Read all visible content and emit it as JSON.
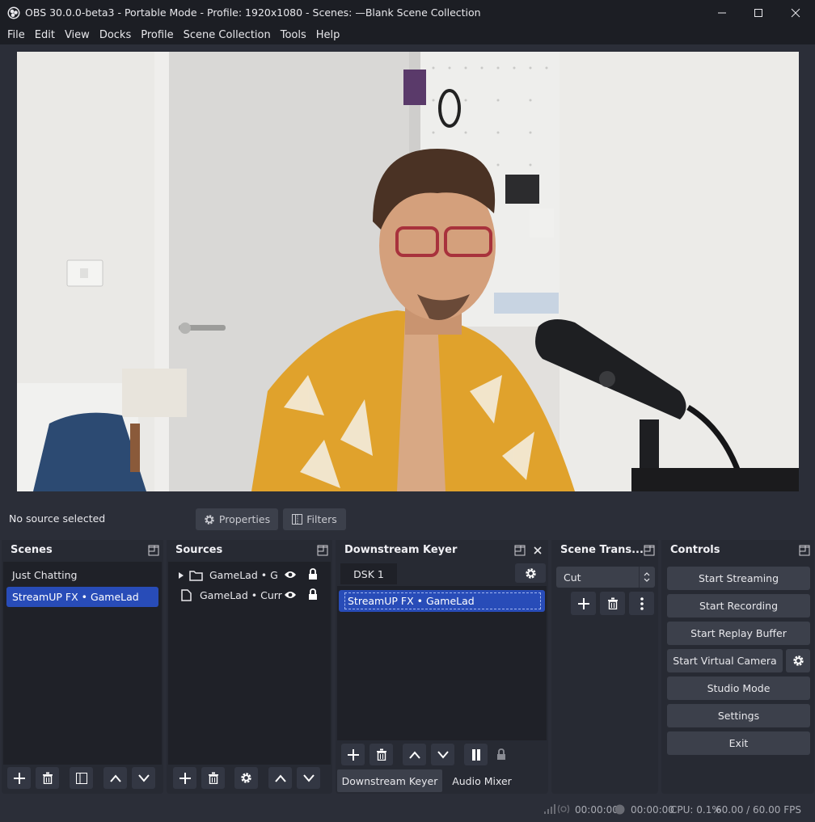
{
  "window": {
    "title": "OBS 30.0.0-beta3 - Portable Mode - Profile: 1920x1080 - Scenes: —Blank Scene Collection",
    "controls": [
      "minimize-icon",
      "maximize-icon",
      "close-icon"
    ]
  },
  "menu": [
    "File",
    "Edit",
    "View",
    "Docks",
    "Profile",
    "Scene Collection",
    "Tools",
    "Help"
  ],
  "context": {
    "label": "No source selected",
    "properties": "Properties",
    "filters": "Filters"
  },
  "scenes": {
    "title": "Scenes",
    "items": [
      "Just Chatting",
      "StreamUP FX • GameLad"
    ],
    "selected_index": 1
  },
  "sources": {
    "title": "Sources",
    "items": [
      {
        "label": "GameLad • Grou",
        "icon": "folder-icon"
      },
      {
        "label": "GameLad • Curren",
        "icon": "file-icon"
      }
    ]
  },
  "dsk": {
    "title": "Downstream Keyer",
    "tab": "DSK 1",
    "item": "StreamUP FX • GameLad",
    "bottom_tabs": [
      "Downstream Keyer",
      "Audio Mixer"
    ]
  },
  "transitions": {
    "title": "Scene Trans...",
    "current": "Cut"
  },
  "controls": {
    "title": "Controls",
    "buttons": [
      "Start Streaming",
      "Start Recording",
      "Start Replay Buffer",
      "Start Virtual Camera",
      "Studio Mode",
      "Settings",
      "Exit"
    ]
  },
  "status": {
    "time1": "00:00:00",
    "time2": "00:00:00",
    "cpu": "CPU: 0.1%",
    "fps": "60.00 / 60.00 FPS"
  },
  "colors": {
    "window_bg": "#2b2e38",
    "dock_bg": "#272a33",
    "accent": "#284cb8",
    "button": "#3c404b"
  }
}
